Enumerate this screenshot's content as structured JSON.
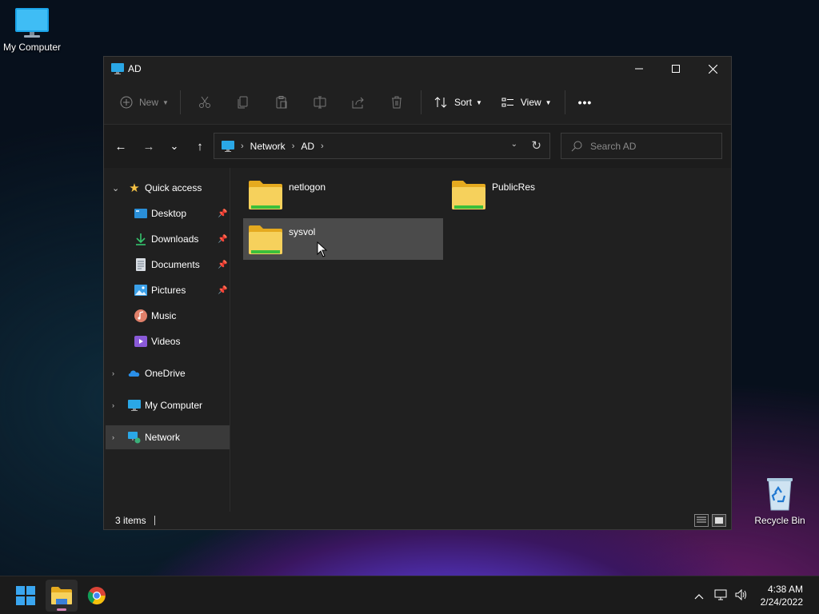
{
  "desktop": {
    "icons": [
      {
        "label": "My Computer"
      },
      {
        "label": "Recycle Bin"
      }
    ]
  },
  "window": {
    "title": "AD",
    "controls": {
      "minimize": "—",
      "maximize": "☐",
      "close": "✕"
    }
  },
  "toolbar": {
    "new_label": "New",
    "sort_label": "Sort",
    "view_label": "View",
    "more_label": "•••",
    "icons": [
      "cut-icon",
      "copy-icon",
      "paste-icon",
      "rename-icon",
      "share-icon",
      "delete-icon"
    ]
  },
  "navigation": {
    "back": "←",
    "forward": "→",
    "recent": "⌄",
    "up": "↑",
    "breadcrumb": [
      "Network",
      "AD"
    ],
    "crumb_sep": "›",
    "refresh": "↻",
    "dropdown": "⌄",
    "search_placeholder": "Search AD"
  },
  "sidebar": {
    "quick_access": "Quick access",
    "items": [
      {
        "label": "Desktop",
        "pinned": true
      },
      {
        "label": "Downloads",
        "pinned": true
      },
      {
        "label": "Documents",
        "pinned": true
      },
      {
        "label": "Pictures",
        "pinned": true
      },
      {
        "label": "Music",
        "pinned": false
      },
      {
        "label": "Videos",
        "pinned": false
      }
    ],
    "onedrive": "OneDrive",
    "my_computer": "My Computer",
    "network": "Network",
    "selected": "Network"
  },
  "content": {
    "folders": [
      {
        "name": "netlogon",
        "selected": false
      },
      {
        "name": "PublicRes",
        "selected": false
      },
      {
        "name": "sysvol",
        "selected": true
      }
    ]
  },
  "status": {
    "item_count": "3 items"
  },
  "taskbar": {
    "apps": [
      "start-button",
      "file-explorer",
      "chrome"
    ],
    "active": "file-explorer"
  },
  "clock": {
    "time": "4:38 AM",
    "date": "2/24/2022"
  },
  "colors": {
    "window_bg": "#202020",
    "selection": "#4b4b4b",
    "sidebar_selection": "#3a3a3a",
    "folder_yellow": "#f4c83d",
    "folder_green": "#3bbf3b",
    "taskbar_bg": "#1b1b1b"
  }
}
